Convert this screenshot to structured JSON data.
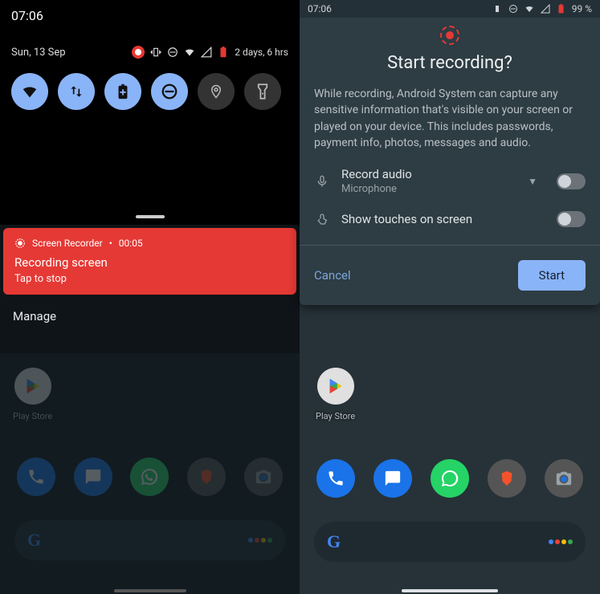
{
  "left": {
    "time": "07:06",
    "date": "Sun, 13 Sep",
    "battery_text": "2 days, 6 hrs",
    "qs": {
      "tiles": [
        {
          "name": "wifi",
          "active": true
        },
        {
          "name": "data",
          "active": true
        },
        {
          "name": "battery-saver",
          "active": true
        },
        {
          "name": "dnd",
          "active": true
        },
        {
          "name": "location",
          "active": false
        },
        {
          "name": "flashlight",
          "active": false
        }
      ]
    },
    "notification": {
      "app": "Screen Recorder",
      "time": "00:05",
      "title": "Recording screen",
      "subtitle": "Tap to stop"
    },
    "manage_label": "Manage",
    "home": {
      "play_label": "Play Store"
    }
  },
  "right": {
    "status_time": "07:06",
    "battery_pct": "99 %",
    "dialog": {
      "title": "Start recording?",
      "body": "While recording, Android System can capture any sensitive information that's visible on your screen or played on your device. This includes passwords, payment info, photos, messages and audio.",
      "record_audio_label": "Record audio",
      "record_audio_source": "Microphone",
      "show_touches_label": "Show touches on screen",
      "cancel": "Cancel",
      "start": "Start",
      "record_audio_on": false,
      "show_touches_on": false
    },
    "home": {
      "play_label": "Play Store"
    }
  }
}
